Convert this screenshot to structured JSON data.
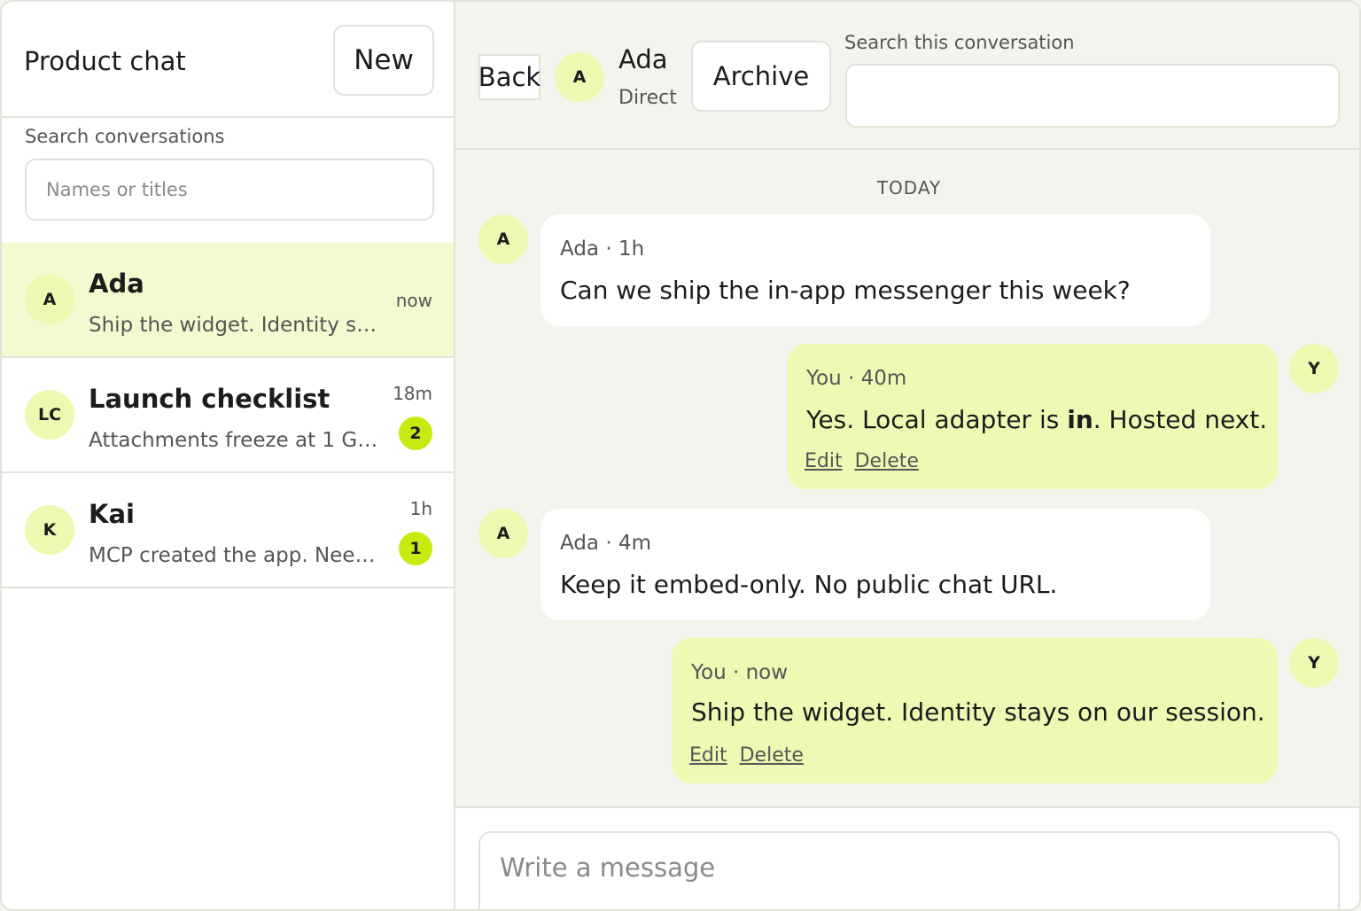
{
  "sidebar": {
    "title": "Product chat",
    "new_label": "New",
    "search_label": "Search conversations",
    "search_placeholder": "Names or titles",
    "conversations": [
      {
        "initials": "A",
        "name": "Ada",
        "preview": "Ship the widget. Identity stays on our session.",
        "time": "now",
        "unread": ""
      },
      {
        "initials": "LC",
        "name": "Launch checklist",
        "preview": "Attachments freeze at 1 GB...",
        "time": "18m",
        "unread": "2"
      },
      {
        "initials": "K",
        "name": "Kai",
        "preview": "MCP created the app. Need...",
        "time": "1h",
        "unread": "1"
      }
    ]
  },
  "header": {
    "back_label": "Back",
    "peer_initials": "A",
    "peer_name": "Ada",
    "peer_kind": "Direct",
    "archive_label": "Archive",
    "search_label": "Search this conversation",
    "search_value": ""
  },
  "thread": {
    "day_label": "TODAY",
    "messages": [
      {
        "author": "Ada",
        "initials": "A",
        "meta": "Ada · 1h",
        "text": "Can we ship the in-app messenger this week?",
        "mine": false
      },
      {
        "author": "You",
        "initials": "Y",
        "meta": "You · 40m",
        "text_before": "Yes. Local adapter is ",
        "text_bold": "in",
        "text_after": ". Hosted next.",
        "mine": true,
        "edit": "Edit",
        "delete": "Delete"
      },
      {
        "author": "Ada",
        "initials": "A",
        "meta": "Ada · 4m",
        "text": "Keep it embed-only. No public chat URL.",
        "mine": false
      },
      {
        "author": "You",
        "initials": "Y",
        "meta": "You · now",
        "text": "Ship the widget. Identity stays on our session.",
        "mine": true,
        "edit": "Edit",
        "delete": "Delete"
      }
    ]
  },
  "composer": {
    "placeholder": "Write a message"
  },
  "colors": {
    "accent": "#c9ea10",
    "avatar_bg": "#eef8b0",
    "active_row": "#f3fad0",
    "my_bubble": "#eff9b4"
  }
}
